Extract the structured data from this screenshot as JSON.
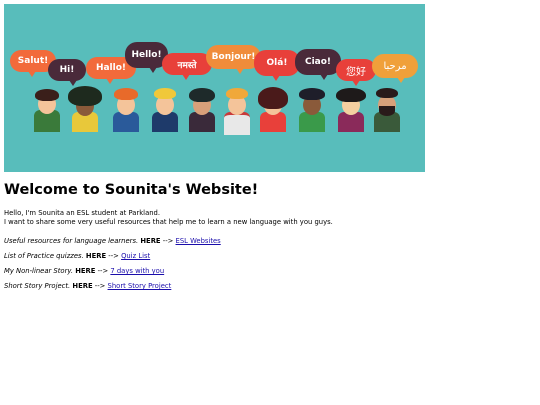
{
  "banner": {
    "background": "#58bdbb",
    "bubbles": [
      {
        "text": "Salut!",
        "color": "#f26a3b"
      },
      {
        "text": "Hi!",
        "color": "#4a2a3a"
      },
      {
        "text": "Hallo!",
        "color": "#f26a3b"
      },
      {
        "text": "Hello!",
        "color": "#4a2a3a"
      },
      {
        "text": "नमस्ते",
        "color": "#e8403a"
      },
      {
        "text": "Bonjour!",
        "color": "#f08c3a"
      },
      {
        "text": "Olá!",
        "color": "#e8403a"
      },
      {
        "text": "Ciao!",
        "color": "#4a2a3a"
      },
      {
        "text": "您好",
        "color": "#e8403a"
      },
      {
        "text": "مرحبا",
        "color": "#f0a03a"
      }
    ]
  },
  "page": {
    "title": "Welcome to Sounita's Website!",
    "intro_line1": "Hello, I'm Sounita an ESL student at Parkland.",
    "intro_line2": "I want to share some very useful resources that help me to learn a new language with you guys."
  },
  "resources": [
    {
      "label": "Useful resources for language learners.",
      "here": "HERE",
      "arrow": "-->",
      "link": "ESL Websites"
    },
    {
      "label": "List of Practice quizzes.",
      "here": "HERE",
      "arrow": "-->",
      "link": "Quiz List"
    },
    {
      "label": "My Non-linear Story.",
      "here": "HERE",
      "arrow": "-->",
      "link": "7 days with you"
    },
    {
      "label": "Short Story Project.",
      "here": "HERE",
      "arrow": "-->",
      "link": "Short Story Project"
    }
  ]
}
